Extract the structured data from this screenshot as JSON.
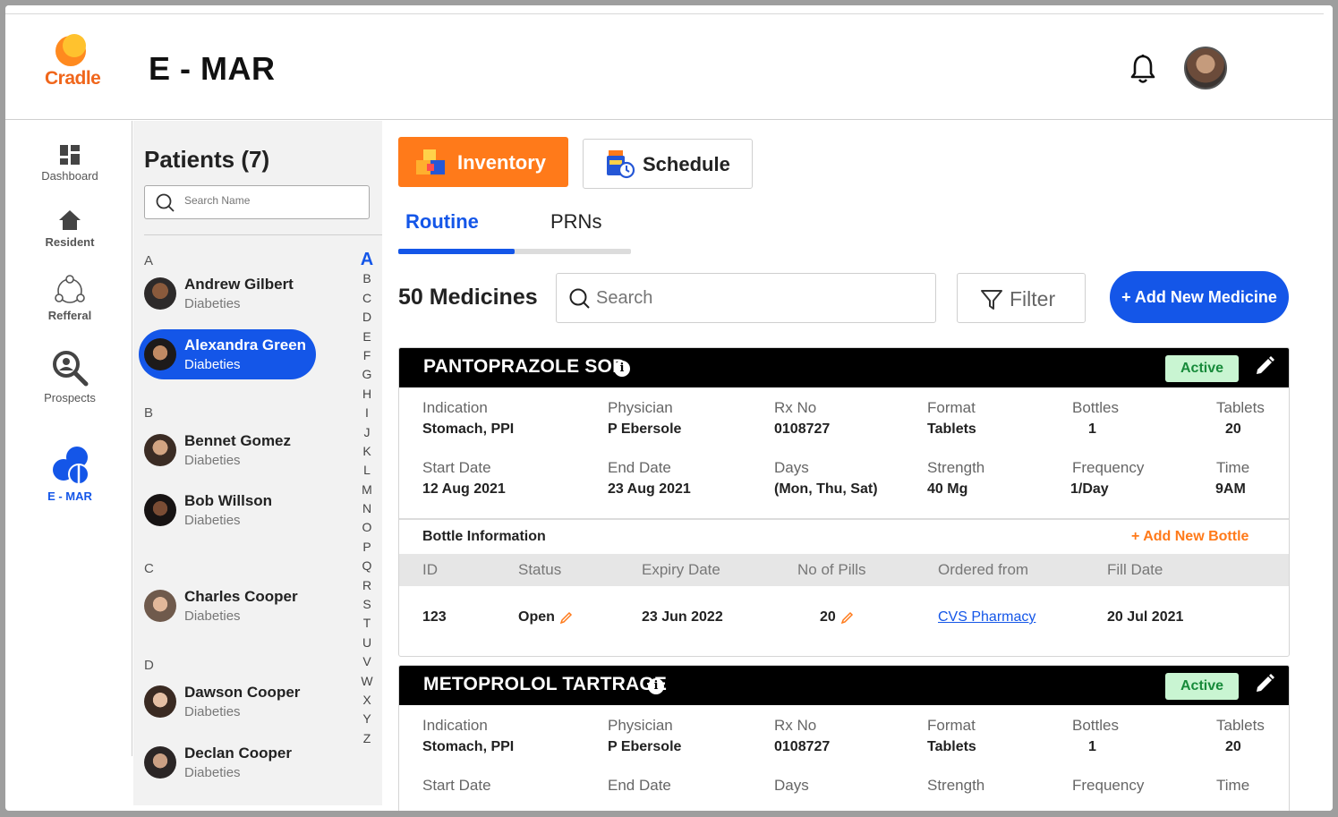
{
  "app": {
    "logo_text": "Cradle",
    "title": "E - MAR"
  },
  "nav": {
    "items": [
      {
        "label": "Dashboard",
        "icon": "dashboard-icon"
      },
      {
        "label": "Resident",
        "icon": "home-icon"
      },
      {
        "label": "Refferal",
        "icon": "referral-icon"
      },
      {
        "label": "Prospects",
        "icon": "prospects-search-icon"
      },
      {
        "label": "E - MAR",
        "icon": "pills-icon",
        "active": true
      }
    ]
  },
  "patients": {
    "title": "Patients (7)",
    "search_placeholder": "Search Name",
    "groups": [
      {
        "letter": "A",
        "items": [
          {
            "name": "Andrew Gilbert",
            "condition": "Diabeties"
          },
          {
            "name": "Alexandra Green",
            "condition": "Diabeties",
            "selected": true
          }
        ]
      },
      {
        "letter": "B",
        "items": [
          {
            "name": "Bennet  Gomez",
            "condition": "Diabeties"
          },
          {
            "name": "Bob Willson",
            "condition": "Diabeties"
          }
        ]
      },
      {
        "letter": "C",
        "items": [
          {
            "name": "Charles Cooper",
            "condition": "Diabeties"
          }
        ]
      },
      {
        "letter": "D",
        "items": [
          {
            "name": "Dawson Cooper",
            "condition": "Diabeties"
          },
          {
            "name": "Declan Cooper",
            "condition": "Diabeties"
          }
        ]
      }
    ],
    "alphabet": [
      "A",
      "B",
      "C",
      "D",
      "E",
      "F",
      "G",
      "H",
      "I",
      "J",
      "K",
      "L",
      "M",
      "N",
      "O",
      "P",
      "Q",
      "R",
      "S",
      "T",
      "U",
      "V",
      "W",
      "X",
      "Y",
      "Z"
    ],
    "alphabet_active": "A"
  },
  "main": {
    "inventory_label": "Inventory",
    "schedule_label": "Schedule",
    "tabs": [
      {
        "label": "Routine",
        "active": true
      },
      {
        "label": "PRNs"
      }
    ],
    "count_label": "50 Medicines",
    "search_placeholder": "Search",
    "filter_label": "Filter",
    "add_label": "+ Add New Medicine"
  },
  "medicines": [
    {
      "name": "PANTOPRAZOLE SOD",
      "status": "Active",
      "fields": {
        "indication_label": "Indication",
        "indication": "Stomach, PPI",
        "physician_label": "Physician",
        "physician": "P Ebersole",
        "rx_label": "Rx No",
        "rx": "0108727",
        "format_label": "Format",
        "format": "Tablets",
        "bottles_label": "Bottles",
        "bottles": "1",
        "tablets_label": "Tablets",
        "tablets": "20",
        "start_label": "Start Date",
        "start": "12 Aug 2021",
        "end_label": "End Date",
        "end": "23 Aug 2021",
        "days_label": "Days",
        "days": "(Mon, Thu, Sat)",
        "strength_label": "Strength",
        "strength": "40 Mg",
        "frequency_label": "Frequency",
        "frequency": "1/Day",
        "time_label": "Time",
        "time": "9AM"
      },
      "bottle_info": {
        "title": "Bottle Information",
        "add_label": "+ Add New Bottle",
        "columns": [
          "ID",
          "Status",
          "Expiry Date",
          "No of Pills",
          "Ordered from",
          "Fill Date"
        ],
        "rows": [
          {
            "id": "123",
            "status": "Open",
            "expiry": "23 Jun 2022",
            "pills": "20",
            "ordered_from": "CVS Pharmacy",
            "fill_date": "20 Jul 2021"
          }
        ]
      }
    },
    {
      "name": "METOPROLOL TARTRAGE",
      "status": "Active",
      "fields": {
        "indication_label": "Indication",
        "indication": "Stomach, PPI",
        "physician_label": "Physician",
        "physician": "P Ebersole",
        "rx_label": "Rx No",
        "rx": "0108727",
        "format_label": "Format",
        "format": "Tablets",
        "bottles_label": "Bottles",
        "bottles": "1",
        "tablets_label": "Tablets",
        "tablets": "20",
        "start_label": "Start Date",
        "end_label": "End Date",
        "days_label": "Days",
        "strength_label": "Strength",
        "frequency_label": "Frequency",
        "time_label": "Time"
      }
    }
  ],
  "colors": {
    "accent": "#1456e8",
    "orange": "#ff7a1a",
    "active_bg": "#c9f5d2",
    "active_text": "#178a3a"
  }
}
